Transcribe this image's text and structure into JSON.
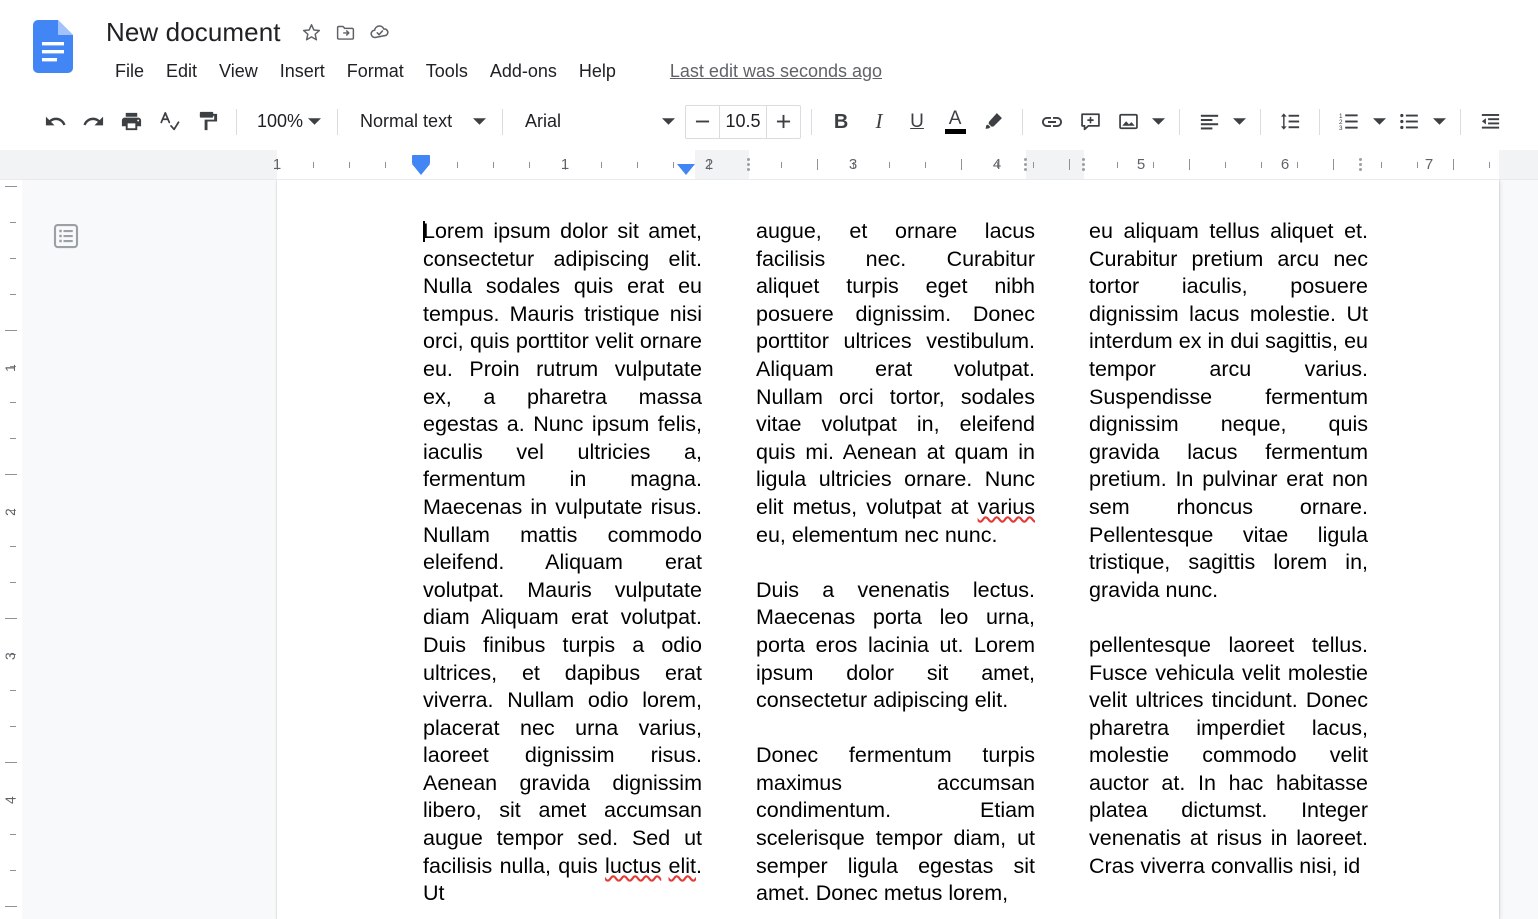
{
  "app": {
    "logo_icon": "google-docs-logo",
    "document_title": "New document",
    "title_actions": [
      {
        "name": "star-icon",
        "label": "Star"
      },
      {
        "name": "move-to-folder-icon",
        "label": "Move to folder"
      },
      {
        "name": "cloud-saved-icon",
        "label": "See document status"
      }
    ]
  },
  "menu": {
    "items": [
      "File",
      "Edit",
      "View",
      "Insert",
      "Format",
      "Tools",
      "Add-ons",
      "Help"
    ],
    "last_edit": "Last edit was seconds ago"
  },
  "toolbar": {
    "undo_icon": "undo-icon",
    "redo_icon": "redo-icon",
    "print_icon": "print-icon",
    "spelling_icon": "spelling-check-icon",
    "paint_format_icon": "paint-format-icon",
    "zoom_level": "100%",
    "paragraph_style": "Normal text",
    "font_family": "Arial",
    "font_size": "10.5",
    "decrease_font_label": "−",
    "increase_font_label": "+",
    "bold_label": "B",
    "italic_label": "I",
    "underline_label": "U",
    "text_color_label": "A",
    "text_color_value": "#000000",
    "highlight_icon": "highlight-pen-icon",
    "link_icon": "insert-link-icon",
    "comment_icon": "add-comment-icon",
    "image_icon": "insert-image-icon",
    "align_icon": "align-left-icon",
    "line_spacing_icon": "line-spacing-icon",
    "numbered_list_icon": "numbered-list-icon",
    "bulleted_list_icon": "bulleted-list-icon",
    "decrease_indent_icon": "decrease-indent-icon",
    "caret_icon": "chevron-down-icon"
  },
  "ruler": {
    "horizontal_numbers": [
      "1",
      "1",
      "2",
      "3",
      "4",
      "5",
      "6",
      "7"
    ],
    "vertical_numbers": [
      "1",
      "2",
      "3",
      "4"
    ],
    "left_indent_marker": "left-indent-marker",
    "first_line_indent_marker": "first-line-indent-marker",
    "column_handle": "column-divider-handle"
  },
  "sidebar": {
    "outline_icon": "document-outline-icon"
  },
  "document": {
    "columns": [
      {
        "paragraphs": [
          {
            "runs": [
              {
                "text": "Lorem ipsum dolor sit amet, consectetur adipiscing elit. Nulla sodales quis erat eu tempus. Mauris tristique nisi orci, quis porttitor velit ornare eu. Proin rutrum vulputate ex, a pharetra massa egestas a. Nunc ipsum felis, iaculis vel ultricies a, fermentum in magna. Maecenas in vulputate risus. Nullam mattis commodo eleifend. Aliquam erat volutpat. Mauris vulputate diam Aliquam erat volutpat. Duis finibus turpis a odio ultrices, et dapibus erat viverra. Nullam odio lorem, placerat nec urna varius, laoreet dignissim risus. Aenean gravida dignissim libero, sit amet accumsan augue tempor sed. Sed ut facilisis nulla, quis "
              },
              {
                "text": "luctus",
                "misspelled": true
              },
              {
                "text": " "
              },
              {
                "text": "elit",
                "misspelled": true
              },
              {
                "text": ". Ut"
              }
            ]
          }
        ]
      },
      {
        "paragraphs": [
          {
            "runs": [
              {
                "text": "augue, et ornare lacus facilisis nec. Curabitur aliquet turpis eget nibh posuere dignissim. Donec porttitor ultrices vestibulum. Aliquam erat volutpat. Nullam orci tortor, sodales vitae volutpat in, eleifend quis mi. Aenean at quam in ligula ultricies ornare. Nunc elit metus, volutpat at "
              },
              {
                "text": "varius",
                "misspelled": true
              },
              {
                "text": " eu, elementum nec nunc."
              }
            ]
          },
          {
            "runs": [
              {
                "text": "Duis a venenatis lectus. Maecenas porta leo urna, porta eros lacinia ut. Lorem ipsum dolor sit amet, consectetur adipiscing elit."
              }
            ]
          },
          {
            "runs": [
              {
                "text": "Donec fermentum turpis maximus accumsan condimentum. Etiam scelerisque tempor diam, ut semper ligula egestas sit amet. Donec metus lorem,"
              }
            ]
          }
        ]
      },
      {
        "paragraphs": [
          {
            "runs": [
              {
                "text": "eu aliquam tellus aliquet et. Curabitur pretium arcu nec tortor iaculis, posuere dignissim lacus molestie. Ut interdum ex in dui sagittis, eu tempor arcu varius. Suspendisse fermentum dignissim neque, quis gravida lacus fermentum pretium. In pulvinar erat non sem rhoncus ornare. Pellentesque vitae ligula tristique, sagittis lorem in, gravida nunc."
              }
            ]
          },
          {
            "runs": [
              {
                "text": "pellentesque laoreet tellus. Fusce vehicula velit molestie velit ultrices tincidunt. Donec pharetra imperdiet lacus, molestie commodo velit auctor at. In hac habitasse platea dictumst. Integer venenatis at risus in laoreet. Cras viverra convallis nisi, id"
              }
            ]
          }
        ]
      }
    ]
  },
  "colors": {
    "brand_blue": "#4285f4",
    "docs_logo_blue": "#4285f4",
    "text_primary": "#202124",
    "text_secondary": "#5f6368",
    "canvas": "#f8f9fa",
    "misspell_red": "#e53935"
  }
}
